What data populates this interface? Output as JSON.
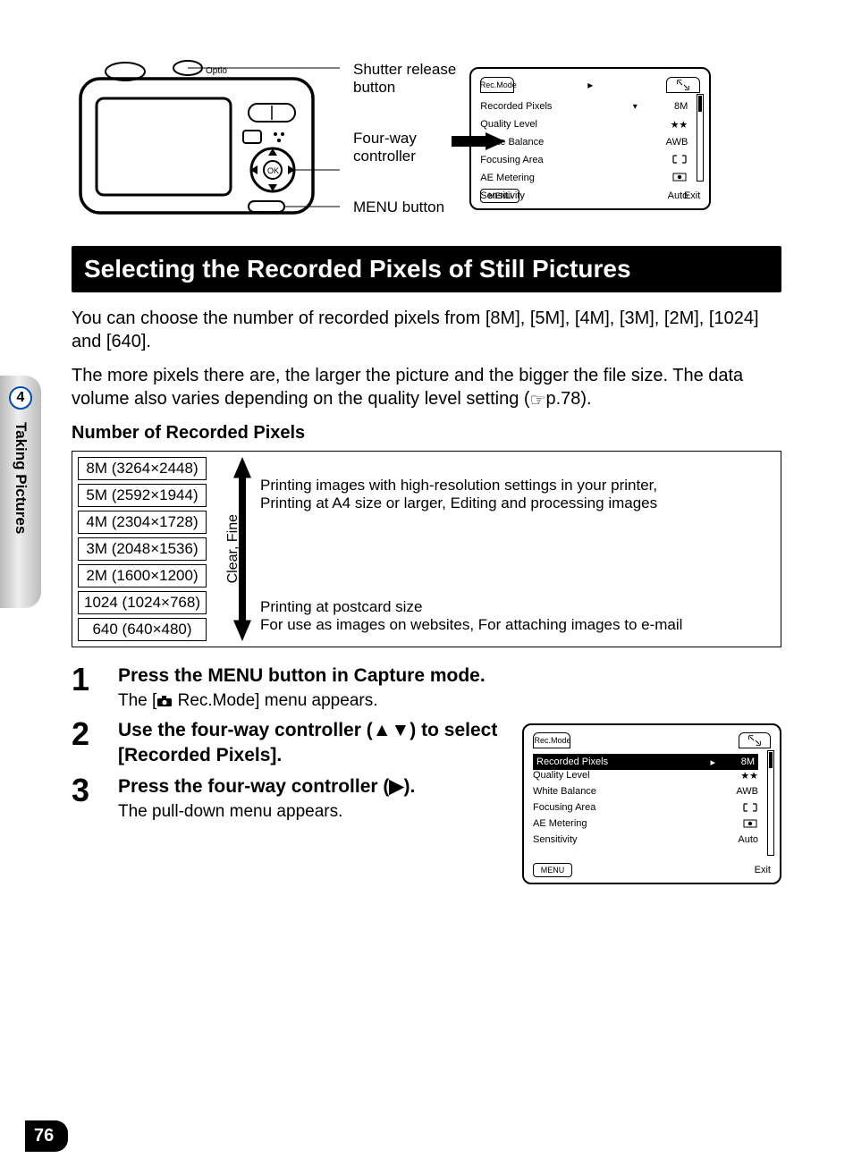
{
  "side_tab": {
    "chapter_num": "4",
    "chapter_title": "Taking Pictures"
  },
  "page_number": "76",
  "diagram": {
    "callouts": {
      "shutter_l1": "Shutter release",
      "shutter_l2": "button",
      "fourway_l1": "Four-way",
      "fourway_l2": "controller",
      "menu": "MENU button"
    }
  },
  "lcd_top": {
    "tab_left_label": "Rec.Mode",
    "rows": {
      "recorded_pixels": {
        "label": "Recorded Pixels",
        "value": "8M"
      },
      "quality_level": {
        "label": "Quality Level",
        "value": "★★"
      },
      "white_balance": {
        "label": "White Balance",
        "value": "AWB"
      },
      "focusing_area": {
        "label": "Focusing Area"
      },
      "ae_metering": {
        "label": "AE Metering"
      },
      "sensitivity": {
        "label": "Sensitivity",
        "value": "Auto"
      }
    },
    "footer": {
      "menu": "MENU",
      "exit": "Exit"
    }
  },
  "section_title": "Selecting the Recorded Pixels of Still Pictures",
  "intro_p1": "You can choose the number of recorded pixels from [8M], [5M], [4M], [3M], [2M], [1024] and [640].",
  "intro_p2_a": "The more pixels there are, the larger the picture and the bigger the file size. The data volume also varies depending on the quality level setting (",
  "intro_p2_b": "p.78).",
  "table_heading": "Number of Recorded Pixels",
  "pixel_sizes": [
    "8M (3264×2448)",
    "5M (2592×1944)",
    "4M (2304×1728)",
    "3M (2048×1536)",
    "2M (1600×1200)",
    "1024 (1024×768)",
    "640 (640×480)"
  ],
  "quality_axis_label": "Clear, Fine",
  "usage": {
    "top_l1": "Printing images with high-resolution settings in your printer,",
    "top_l2": "Printing at A4 size or larger, Editing and processing images",
    "bot_l1": "Printing at postcard size",
    "bot_l2": "For use as images on websites, For attaching images to e-mail"
  },
  "steps": {
    "s1": {
      "num": "1",
      "title": "Press the MENU button in Capture mode.",
      "sub_a": "The [",
      "sub_b": " Rec.Mode] menu appears."
    },
    "s2": {
      "num": "2",
      "title": "Use the four-way controller (▲▼) to select [Recorded Pixels]."
    },
    "s3": {
      "num": "3",
      "title": "Press the four-way controller (▶).",
      "sub": "The pull-down menu appears."
    }
  },
  "lcd_bottom": {
    "tab_left_label": "Rec.Mode",
    "rows": {
      "recorded_pixels": {
        "label": "Recorded Pixels",
        "value": "8M"
      },
      "quality_level": {
        "label": "Quality Level",
        "value": "★★"
      },
      "white_balance": {
        "label": "White Balance",
        "value": "AWB"
      },
      "focusing_area": {
        "label": "Focusing Area"
      },
      "ae_metering": {
        "label": "AE Metering"
      },
      "sensitivity": {
        "label": "Sensitivity",
        "value": "Auto"
      }
    },
    "footer": {
      "menu": "MENU",
      "exit": "Exit"
    }
  }
}
